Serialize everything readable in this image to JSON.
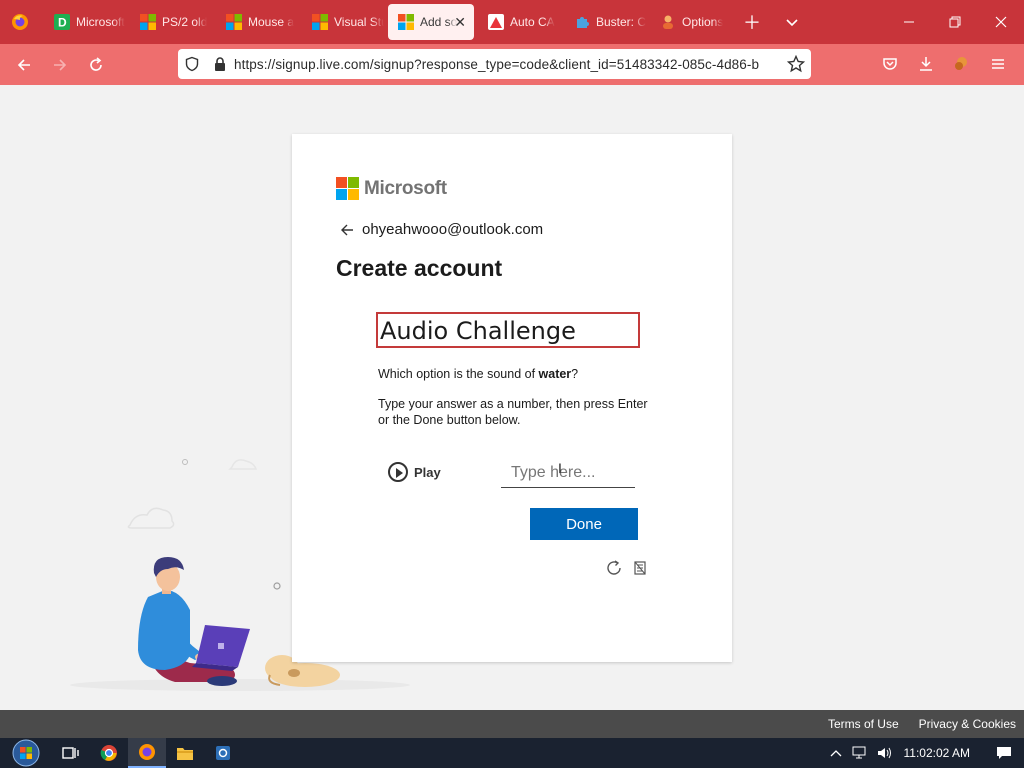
{
  "browser": {
    "tabs": [
      {
        "label": "Microsoft",
        "icon": "d-app-icon",
        "active": false
      },
      {
        "label": "PS/2 old",
        "icon": "microsoft-icon",
        "active": false
      },
      {
        "label": "Mouse a",
        "icon": "microsoft-icon",
        "active": false
      },
      {
        "label": "Visual Stu",
        "icon": "microsoft-icon",
        "active": false
      },
      {
        "label": "Add so",
        "icon": "microsoft-icon",
        "active": true
      },
      {
        "label": "Auto CA",
        "icon": "autocad-icon",
        "active": false
      },
      {
        "label": "Buster: C",
        "icon": "puzzle-icon",
        "active": false
      },
      {
        "label": "Options",
        "icon": "options-icon",
        "active": false
      }
    ],
    "url": "https://signup.live.com/signup?response_type=code&client_id=51483342-085c-4d86-b"
  },
  "page": {
    "brand": "Microsoft",
    "identity": "ohyeahwooo@outlook.com",
    "title": "Create account",
    "challenge": {
      "heading": "Audio Challenge",
      "question_prefix": "Which option is the sound of ",
      "question_keyword": "water",
      "question_suffix": "?",
      "instructions": "Type your answer as a number, then press Enter or the Done button below.",
      "play_label": "Play",
      "answer_placeholder": "Type here...",
      "done_label": "Done"
    }
  },
  "footer": {
    "terms": "Terms of Use",
    "privacy": "Privacy & Cookies"
  },
  "taskbar": {
    "clock": "11:02:02 AM"
  },
  "colors": {
    "tabbar": "#c8343a",
    "navbar": "#ee6e6e",
    "done_button": "#0067b8",
    "challenge_border": "#c43a3a"
  }
}
